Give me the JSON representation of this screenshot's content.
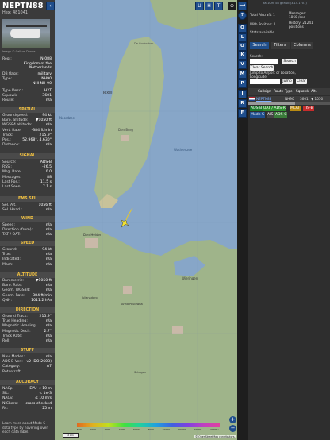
{
  "aircraft": {
    "callsign": "NEPTN88",
    "hex_label": "Hex:",
    "hex": "481041",
    "photo_credit": "Image © Callum Dunne",
    "reg_label": "Reg.:",
    "reg": "N-088",
    "country": "Kingdom of the Netherlands",
    "dbflags_label": "DB flags:",
    "dbflags": "military",
    "type_label": "Type:",
    "type": "NH90",
    "type_long": "NHI NH-90",
    "typedesc_label": "Type Desc.:",
    "typedesc": "H2T",
    "squawk_label": "Squawk:",
    "squawk": "3601",
    "route_label": "Route:",
    "route": "n/a"
  },
  "sections": {
    "spatial": "SPATIAL",
    "signal": "SIGNAL",
    "fmssel": "FMS SEL",
    "wind": "WIND",
    "speed": "SPEED",
    "altitude": "ALTITUDE",
    "direction": "DIRECTION",
    "stuff": "STUFF",
    "accuracy": "ACCURACY"
  },
  "spatial": [
    {
      "k": "Groundspeed:",
      "v": "94 kt"
    },
    {
      "k": "Baro. altitude:",
      "v": "▼1050 ft"
    },
    {
      "k": "WGS84 altitude:",
      "v": "n/a"
    },
    {
      "k": "Vert. Rate:",
      "v": "-384 ft/min"
    },
    {
      "k": "Track:",
      "v": "215.9°"
    },
    {
      "k": "Pos.:",
      "v": "52.968°, 4.630°"
    },
    {
      "k": "Distance:",
      "v": "n/a"
    }
  ],
  "signal": [
    {
      "k": "Source:",
      "v": "ADS-B"
    },
    {
      "k": "RSSI:",
      "v": "-26.5"
    },
    {
      "k": "Msg. Rate:",
      "v": "0.0"
    },
    {
      "k": "Messages:",
      "v": "88"
    },
    {
      "k": "Last Pos.:",
      "v": "11.5 s"
    },
    {
      "k": "Last Seen:",
      "v": "7.1 s"
    }
  ],
  "fmssel": [
    {
      "k": "Sel. Alt.:",
      "v": "1056 ft"
    },
    {
      "k": "Sel. Head.:",
      "v": "n/a"
    }
  ],
  "wind": [
    {
      "k": "Speed:",
      "v": "n/a"
    },
    {
      "k": "Direction (from):",
      "v": "n/a"
    },
    {
      "k": "TAT / OAT:",
      "v": "n/a"
    }
  ],
  "speed": [
    {
      "k": "Ground:",
      "v": "94 kt"
    },
    {
      "k": "True:",
      "v": "n/a"
    },
    {
      "k": "Indicated:",
      "v": "n/a"
    },
    {
      "k": "Mach:",
      "v": "n/a"
    }
  ],
  "altitude": [
    {
      "k": "Barometric:",
      "v": "▼1050 ft"
    },
    {
      "k": "Baro. Rate:",
      "v": "n/a"
    },
    {
      "k": "Geom. WGS84:",
      "v": "n/a"
    },
    {
      "k": "Geom. Rate:",
      "v": "-384 ft/min"
    },
    {
      "k": "QNH:",
      "v": "1011.2 hPa"
    }
  ],
  "direction": [
    {
      "k": "Ground Track:",
      "v": "215.9°"
    },
    {
      "k": "True Heading:",
      "v": "n/a"
    },
    {
      "k": "Magnetic Heading:",
      "v": "n/a"
    },
    {
      "k": "Magnetic Decl.:",
      "v": "2.7°"
    },
    {
      "k": "Track Rate:",
      "v": "n/a"
    },
    {
      "k": "Roll:",
      "v": "n/a"
    }
  ],
  "stuff": [
    {
      "k": "Nav. Modes:",
      "v": "n/a"
    },
    {
      "k": "ADS-B Ver.:",
      "v": "v2 (DO-260B)"
    },
    {
      "k": "Category:",
      "v": "A7"
    },
    {
      "k": "Rotorcraft",
      "v": ""
    }
  ],
  "accuracy": [
    {
      "k": "NACp:",
      "v": "EPU < 10 m"
    },
    {
      "k": "SIL:",
      "v": "< 1e-3"
    },
    {
      "k": "NACv:",
      "v": "≤ 10 m/s"
    },
    {
      "k": "NICbaro:",
      "v": "cross-checked"
    },
    {
      "k": "Rc:",
      "v": "25 m"
    }
  ],
  "footer_note": "Learn more about Mode S data type by hovering over each data label.",
  "map": {
    "label_texel": "Texel",
    "label_den_burg": "Den Burg",
    "label_den_helder": "Den Helder",
    "label_noordzee": "Noordzee",
    "label_wieringen": "Wieringen",
    "label_julianadorp": "Julianadorp",
    "label_anna_paulowna": "Anna Paulowna",
    "label_schagen": "Schagen",
    "label_waddenzee": "Waddenzee",
    "label_de_cocksdorp": "De Cocksdorp",
    "scale": "2 km",
    "attribution": "© OpenStreetMap contributors.",
    "altitude_ticks": [
      "500",
      "1000",
      "2000",
      "4000",
      "6000",
      "8000",
      "10000",
      "20000",
      "30000",
      "40000+"
    ],
    "colors": {
      "water": "#87a6c8",
      "land": "#9fb48a",
      "ac": "#f2e230",
      "track": "#e8c82a"
    }
  },
  "left_controls": [
    "U",
    "H",
    "T"
  ],
  "right_controls": [
    "?",
    "O",
    "L",
    "O",
    "K",
    "V",
    "M",
    "P",
    "I",
    "R",
    "F"
  ],
  "stats": {
    "link": "tar1090 on github (3.14.1701)",
    "total_aircraft_label": "Total Aircraft:",
    "total_aircraft": "1",
    "with_position_label": "With Position:",
    "with_position": "1",
    "messages_label": "Messages:",
    "messages": "1860 /sec",
    "history_label": "History:",
    "history": "21241 positions",
    "stats_available": "Stats available"
  },
  "tabs": [
    "Search",
    "Filters",
    "Columns"
  ],
  "search": {
    "label": "Search:",
    "button": "Search",
    "clear": "Clear Search",
    "jump_label": "Jump to Airport or Location, Longitude:",
    "jump": "Jump",
    "clear2": "Clear"
  },
  "table": {
    "headers": [
      "Callsign",
      "Route",
      "Type",
      "Squawk",
      "Alt."
    ],
    "row": {
      "callsign": "NEPTN88",
      "type": "NH90",
      "squawk": "3601",
      "alt": "▼ 1050"
    }
  },
  "legend": [
    "ADS-B",
    "UAT / ADS-R",
    "MLAT",
    "TIS-B",
    "Mode-S",
    "AIS",
    "ADS-C"
  ],
  "legend_colors": [
    "#1a7a2a",
    "#2d8f2d",
    "#b98a12",
    "#c62c2c",
    "#1f4e8c",
    "#444444",
    "#3a7a3a"
  ]
}
